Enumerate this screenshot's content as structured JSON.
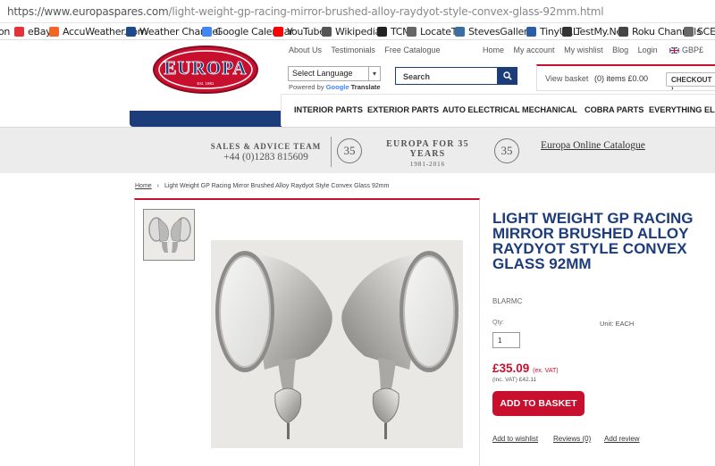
{
  "browser": {
    "url_host": "https://www.europaspares.com",
    "url_path": "/light-weight-gp-racing-mirror-brushed-alloy-raydyot-style-convex-glass-92mm.html",
    "bookmarks": [
      {
        "label": "on",
        "color": "#1a73e8"
      },
      {
        "label": "eBay",
        "color": "#e53238"
      },
      {
        "label": "AccuWeather.com",
        "color": "#f26522"
      },
      {
        "label": "Weather Channel",
        "color": "#1e4a8d"
      },
      {
        "label": "Google Calendar",
        "color": "#4285f4"
      },
      {
        "label": "YouTube",
        "color": "#ff0000"
      },
      {
        "label": "Wikipedia",
        "color": "#555555"
      },
      {
        "label": "TCM",
        "color": "#222222"
      },
      {
        "label": "LocateTV",
        "color": "#666666"
      },
      {
        "label": "StevesGallery",
        "color": "#3b6ea5"
      },
      {
        "label": "TinyURL",
        "color": "#2a5fa8"
      },
      {
        "label": "TestMy.Net",
        "color": "#333333"
      },
      {
        "label": "Roku Channels",
        "color": "#444444"
      },
      {
        "label": "SCE O",
        "color": "#666666"
      }
    ]
  },
  "header": {
    "logo_text": "EUROPA",
    "logo_sub": "Est. 1981",
    "top_links": [
      "About Us",
      "Testimonials",
      "Free Catalogue"
    ],
    "account_links": [
      "Home",
      "My account",
      "My wishlist",
      "Blog",
      "Login"
    ],
    "currency": "GBP£",
    "language_select": "Select Language",
    "powered_by": "Powered by",
    "google": "Google",
    "translate": "Translate",
    "search_placeholder": "Search",
    "view_basket": "View basket",
    "basket_items": "(0) items £0.00",
    "checkout": "CHECKOUT"
  },
  "nav": {
    "items": [
      "INTERIOR PARTS",
      "EXTERIOR PARTS",
      "AUTO ELECTRICAL",
      "MECHANICAL",
      "COBRA PARTS",
      "EVERYTHING ELSE"
    ]
  },
  "strip": {
    "sales_title": "SALES & ADVICE TEAM",
    "sales_phone": "+44 (0)1283 815609",
    "badge": "35",
    "europa_title": "EUROPA FOR 35 YEARS",
    "europa_years": "1981-2016",
    "online_catalogue": "Europa Online Catalogue"
  },
  "breadcrumb": {
    "home": "Home",
    "separator": "›",
    "current": "Light Weight GP Racing Mirror Brushed Alloy Raydyot Style Convex Glass 92mm"
  },
  "product": {
    "title": "LIGHT WEIGHT GP RACING MIRROR BRUSHED ALLOY RAYDYOT STYLE CONVEX GLASS 92MM",
    "sku": "BLARMC",
    "qty_label": "Qty:",
    "qty_value": "1",
    "unit_label": "Unit: EACH",
    "price": "£35.09",
    "price_note": "(ex. VAT)",
    "price_inc": "(inc. VAT) £42.11",
    "add_to_basket": "ADD TO BASKET",
    "add_to_wishlist": "Add to wishlist",
    "reviews": "Reviews (0)",
    "add_review": "Add review"
  },
  "colors": {
    "brand_blue": "#1d3c7a",
    "brand_red": "#c8102e"
  }
}
